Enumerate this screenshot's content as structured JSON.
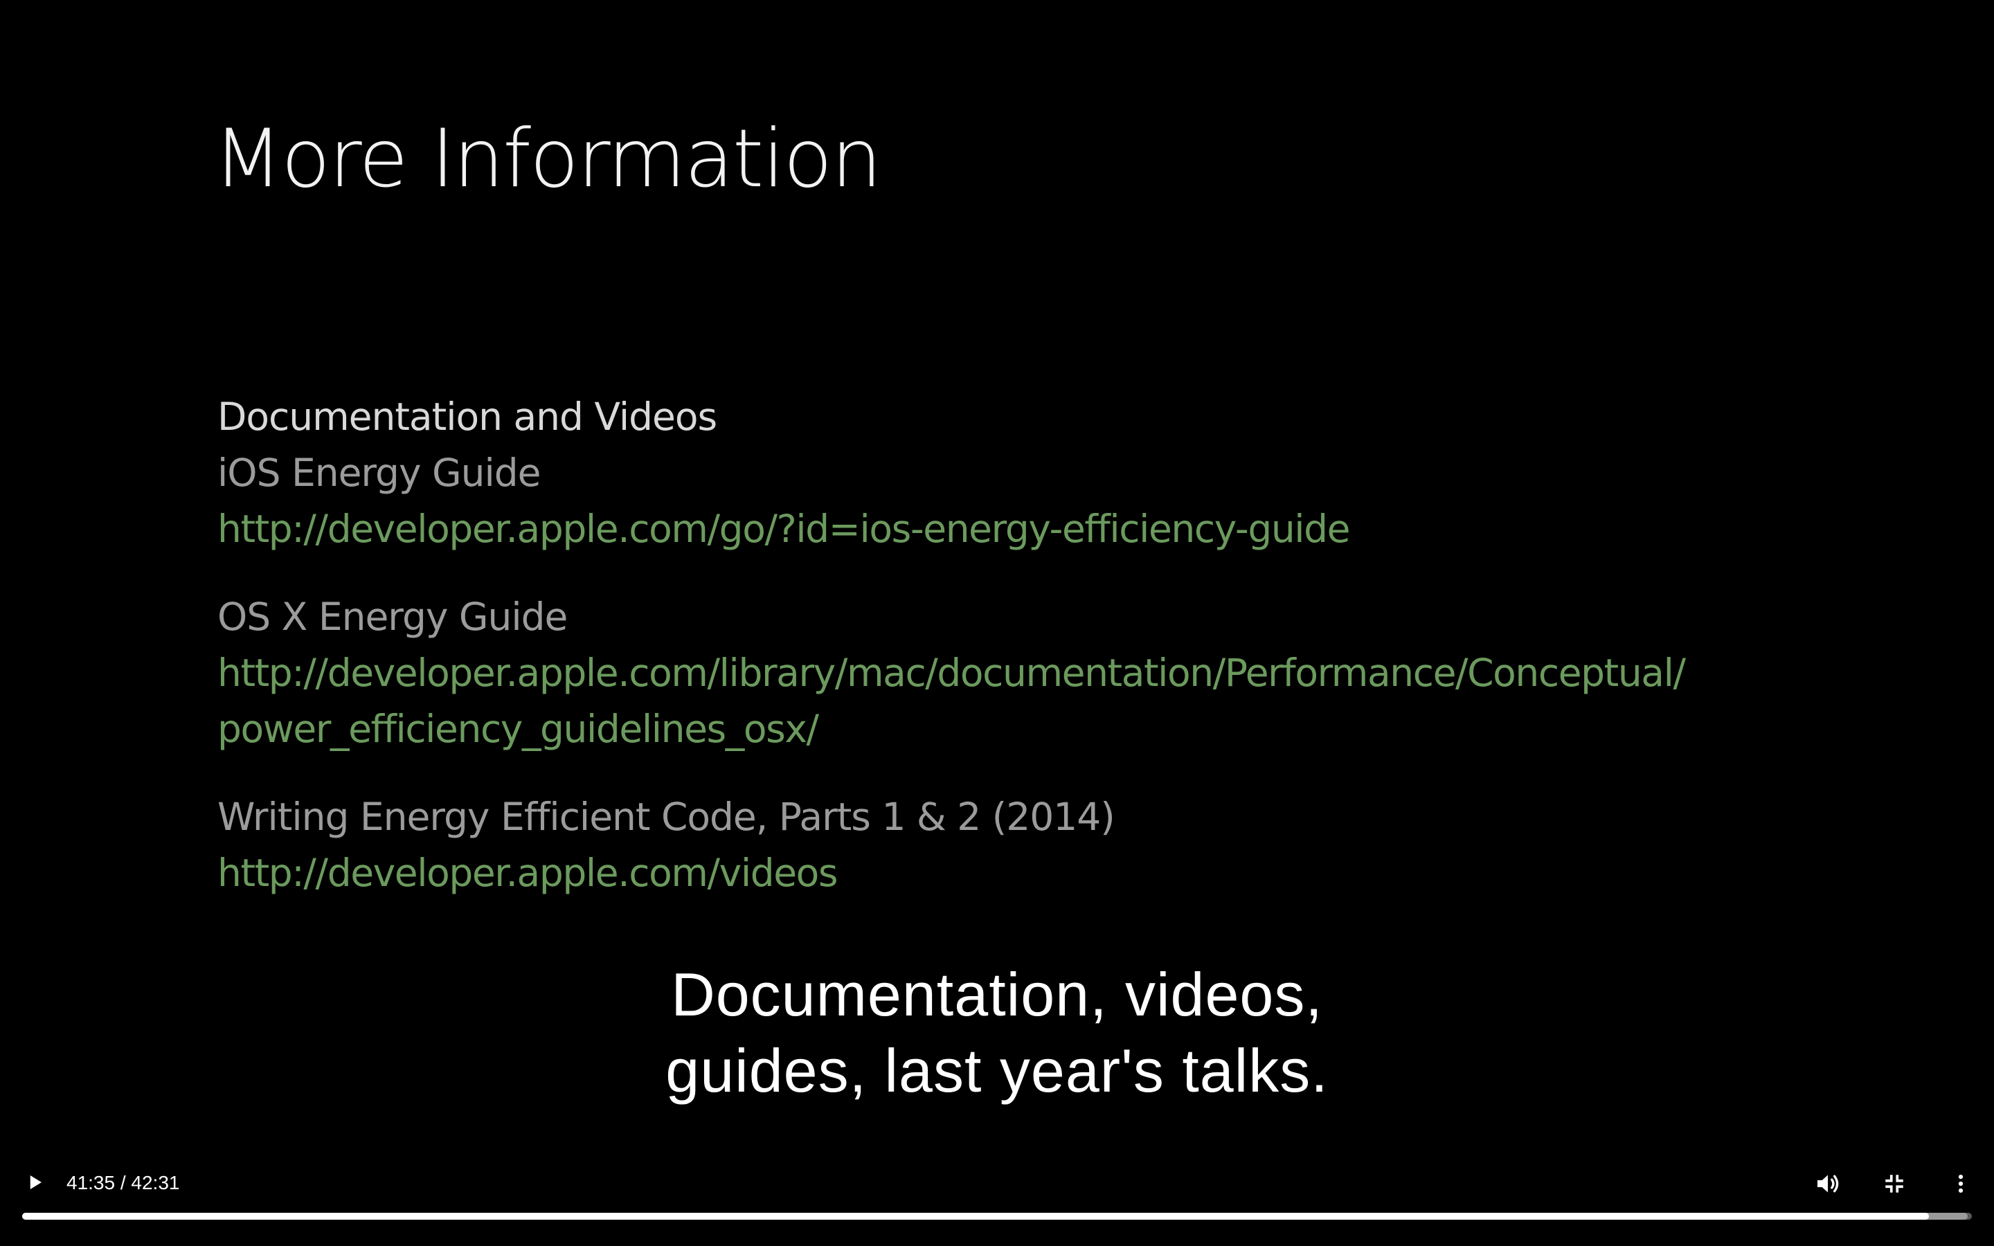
{
  "slide": {
    "title": "More Information",
    "section_heading": "Documentation and Videos",
    "entries": [
      {
        "title": "iOS Energy Guide",
        "links": [
          "http://developer.apple.com/go/?id=ios-energy-efficiency-guide"
        ]
      },
      {
        "title": "OS X Energy Guide",
        "links": [
          "http://developer.apple.com/library/mac/documentation/Performance/Conceptual/",
          "power_efficiency_guidelines_osx/"
        ]
      },
      {
        "title": "Writing Energy Efficient Code, Parts 1 & 2 (2014)",
        "links": [
          "http://developer.apple.com/videos"
        ]
      }
    ]
  },
  "captions": {
    "line1": "Documentation, videos,",
    "line2": "guides, last year's talks."
  },
  "player": {
    "current_time": "41:35",
    "duration": "42:31",
    "time_display": "41:35 / 42:31",
    "progress_fraction": 0.978,
    "buffered_fraction": 0.998,
    "icons": {
      "play": "play-icon",
      "volume": "volume-icon",
      "fullscreen_exit": "exit-fullscreen-icon",
      "more": "more-vert-icon"
    },
    "colors": {
      "played": "#ffffff",
      "track": "#5a5a5a",
      "link_text": "#6c9a5e"
    }
  }
}
